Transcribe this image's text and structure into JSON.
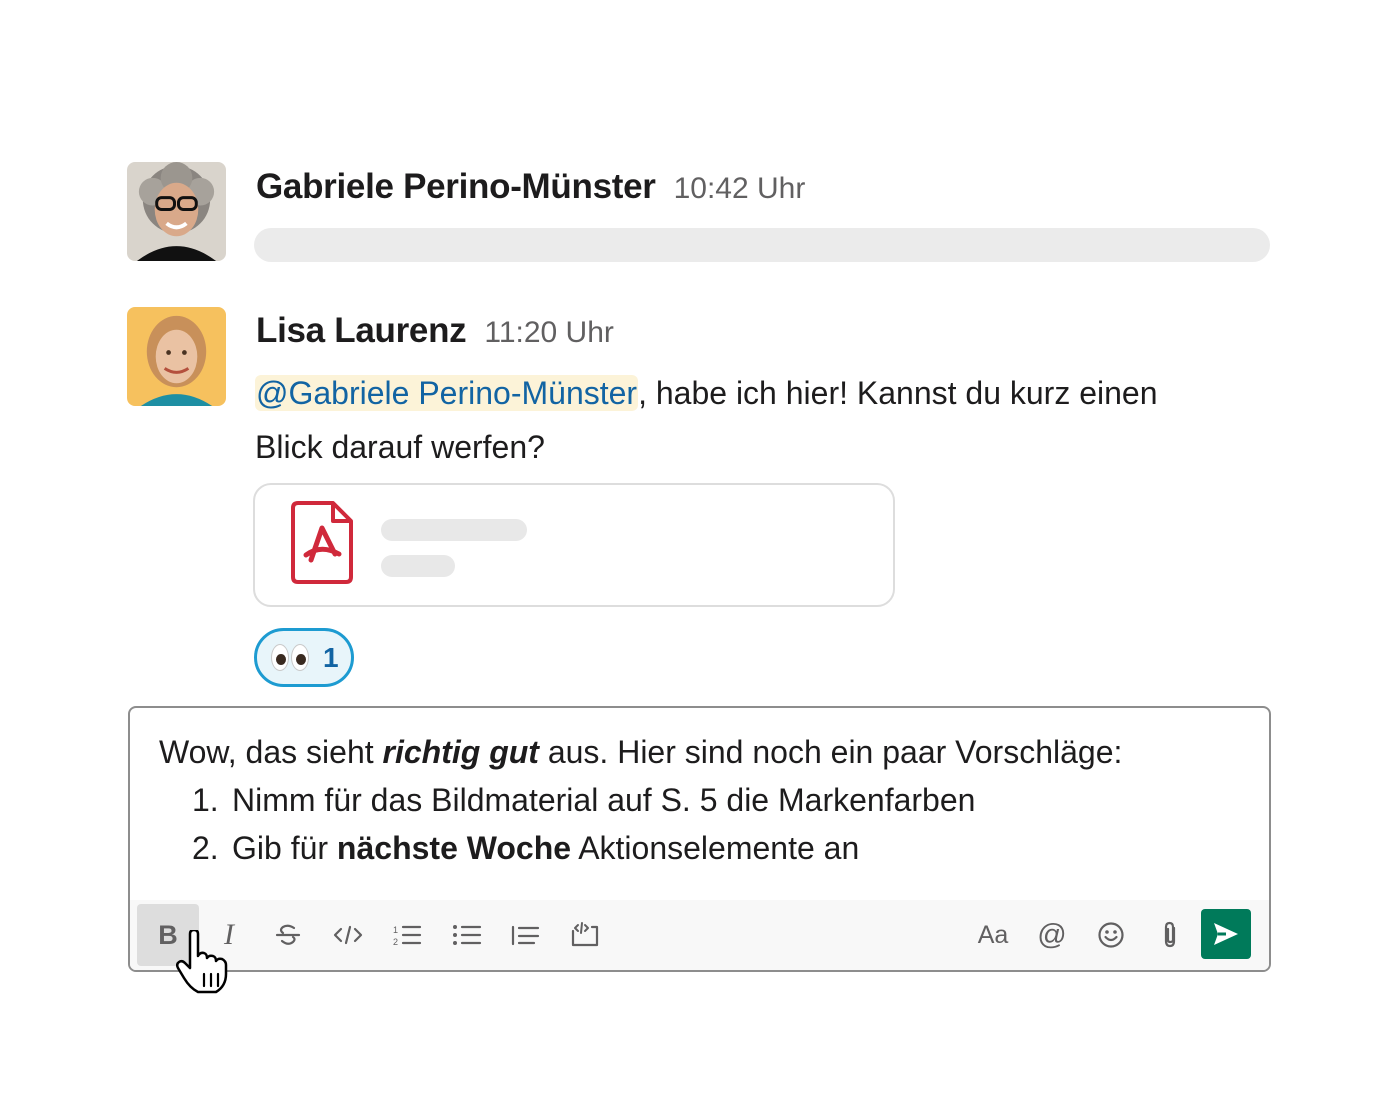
{
  "messages": [
    {
      "sender": "Gabriele Perino-Münster",
      "time": "10:42 Uhr"
    },
    {
      "sender": "Lisa Laurenz",
      "time": "11:20 Uhr",
      "mention": "@Gabriele Perino-Münster",
      "text": ", habe ich hier! Kannst du kurz einen Blick darauf werfen?",
      "attachment_icon": "pdf-icon",
      "reaction": {
        "emoji": "eyes-emoji",
        "count": "1"
      }
    }
  ],
  "composer": {
    "line1_pre": "Wow, das sieht ",
    "line1_bold_italic": "richtig gut",
    "line1_post": " aus. Hier sind noch ein paar Vorschläge:",
    "list": [
      {
        "num": "1.",
        "pre": "Nimm für das Bildmaterial auf S. 5 die Markenfarben",
        "bold": "",
        "post": ""
      },
      {
        "num": "2.",
        "pre": "Gib für ",
        "bold": "nächste Woche",
        "post": " Aktionselemente an"
      }
    ],
    "toolbar": {
      "bold_label": "B",
      "italic_label": "I",
      "format_label": "Aa",
      "mention_label": "@",
      "icons": [
        "bold-icon",
        "italic-icon",
        "strikethrough-icon",
        "code-icon",
        "ordered-list-icon",
        "bullet-list-icon",
        "blockquote-icon",
        "code-block-icon",
        "text-format-icon",
        "mention-icon",
        "emoji-icon",
        "attachment-icon",
        "send-icon"
      ]
    }
  },
  "colors": {
    "mention_bg": "#fcf3d8",
    "mention_text": "#1264a3",
    "reaction_border": "#1d9bd1",
    "send_button": "#007a5a",
    "pdf_red": "#d0293b"
  }
}
